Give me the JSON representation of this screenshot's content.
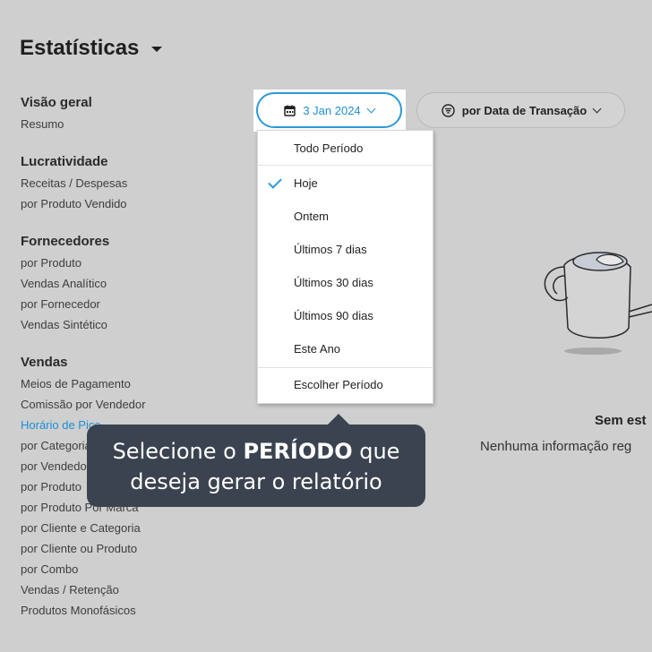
{
  "header": {
    "title": "Estatísticas"
  },
  "sidebar": {
    "sections": [
      {
        "heading": "Visão geral",
        "items": [
          "Resumo"
        ]
      },
      {
        "heading": "Lucratividade",
        "items": [
          "Receitas / Despesas",
          "por Produto Vendido"
        ]
      },
      {
        "heading": "Fornecedores",
        "items": [
          "por Produto",
          "Vendas Analítico",
          "por Fornecedor",
          "Vendas Sintético"
        ]
      },
      {
        "heading": "Vendas",
        "items": [
          "Meios de Pagamento",
          "Comissão por Vendedor",
          "Horário de Pico",
          "por Categoria",
          "por Vendedor",
          "por Produto",
          "por Produto Por Marca",
          "por Cliente e Categoria",
          "por Cliente ou Produto",
          "por Combo",
          "Vendas / Retenção",
          "Produtos Monofásicos"
        ]
      }
    ],
    "active_item": "Horário de Pico"
  },
  "toolbar": {
    "date_label": "3 Jan 2024",
    "transaction_filter_label": "por Data de Transação"
  },
  "period_dropdown": {
    "items": [
      "Todo Período",
      "Hoje",
      "Ontem",
      "Últimos 7 dias",
      "Últimos 30 dias",
      "Últimos 90 dias",
      "Este Ano",
      "Escolher Período"
    ],
    "selected": "Hoje"
  },
  "tooltip": {
    "line1_pre": "Selecione o ",
    "line1_bold": "PERÍODO",
    "line1_post": " que",
    "line2": "deseja gerar o relatório"
  },
  "empty_state": {
    "title": "Sem est",
    "subtitle": "Nenhuma informação reg"
  },
  "colors": {
    "accent": "#1a8fd6",
    "tooltip_bg": "#3b4350",
    "background": "#cfcfcf"
  }
}
